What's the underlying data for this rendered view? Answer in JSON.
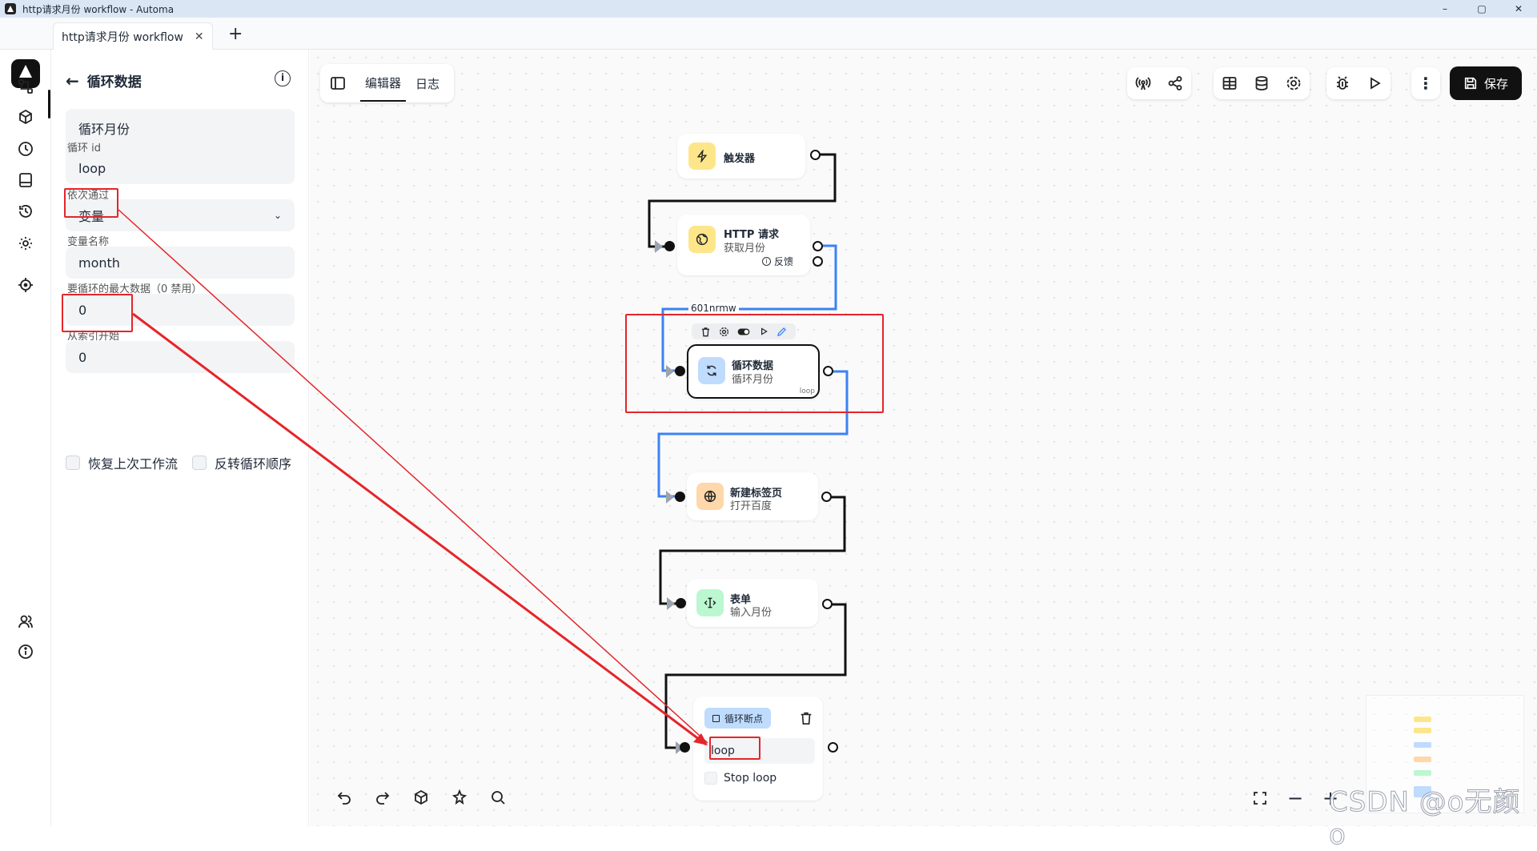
{
  "window": {
    "title": "http请求月份 workflow - Automa",
    "minimize": "–",
    "maximize": "▢",
    "close": "✕"
  },
  "tabs": [
    {
      "label": "http请求月份 workflow",
      "close": "✕"
    }
  ],
  "new_tab": "+",
  "panel": {
    "title": "循环数据",
    "description": "循环月份",
    "loop_id_label": "循环 id",
    "loop_id_value": "loop",
    "through_label": "依次通过",
    "through_value": "变量",
    "var_name_label": "变量名称",
    "var_name_value": "month",
    "max_label": "要循环的最大数据（0 禁用）",
    "max_value": "0",
    "start_label": "从索引开始",
    "start_value": "0",
    "resume_label": "恢复上次工作流",
    "reverse_label": "反转循环顺序"
  },
  "editor": {
    "tab_editor": "编辑器",
    "tab_log": "日志",
    "save": "保存"
  },
  "nodes": {
    "trigger": {
      "title": "触发器"
    },
    "http": {
      "title": "HTTP 请求",
      "sub": "获取月份",
      "fallback": "反馈"
    },
    "loop": {
      "title": "循环数据",
      "sub": "循环月份",
      "tag": "loop",
      "edge_id": "601nrmw"
    },
    "newtab": {
      "title": "新建标签页",
      "sub": "打开百度"
    },
    "form": {
      "title": "表单",
      "sub": "输入月份"
    },
    "breakpoint": {
      "title": "循环断点",
      "input": "loop",
      "stop": "Stop loop"
    }
  },
  "zoom": {
    "minus": "−",
    "plus": "+"
  },
  "watermark": "CSDN @o无颜o",
  "colors": {
    "accent": "#111111",
    "edge_blue": "#3b82f6",
    "annotation_red": "#e5252a"
  }
}
